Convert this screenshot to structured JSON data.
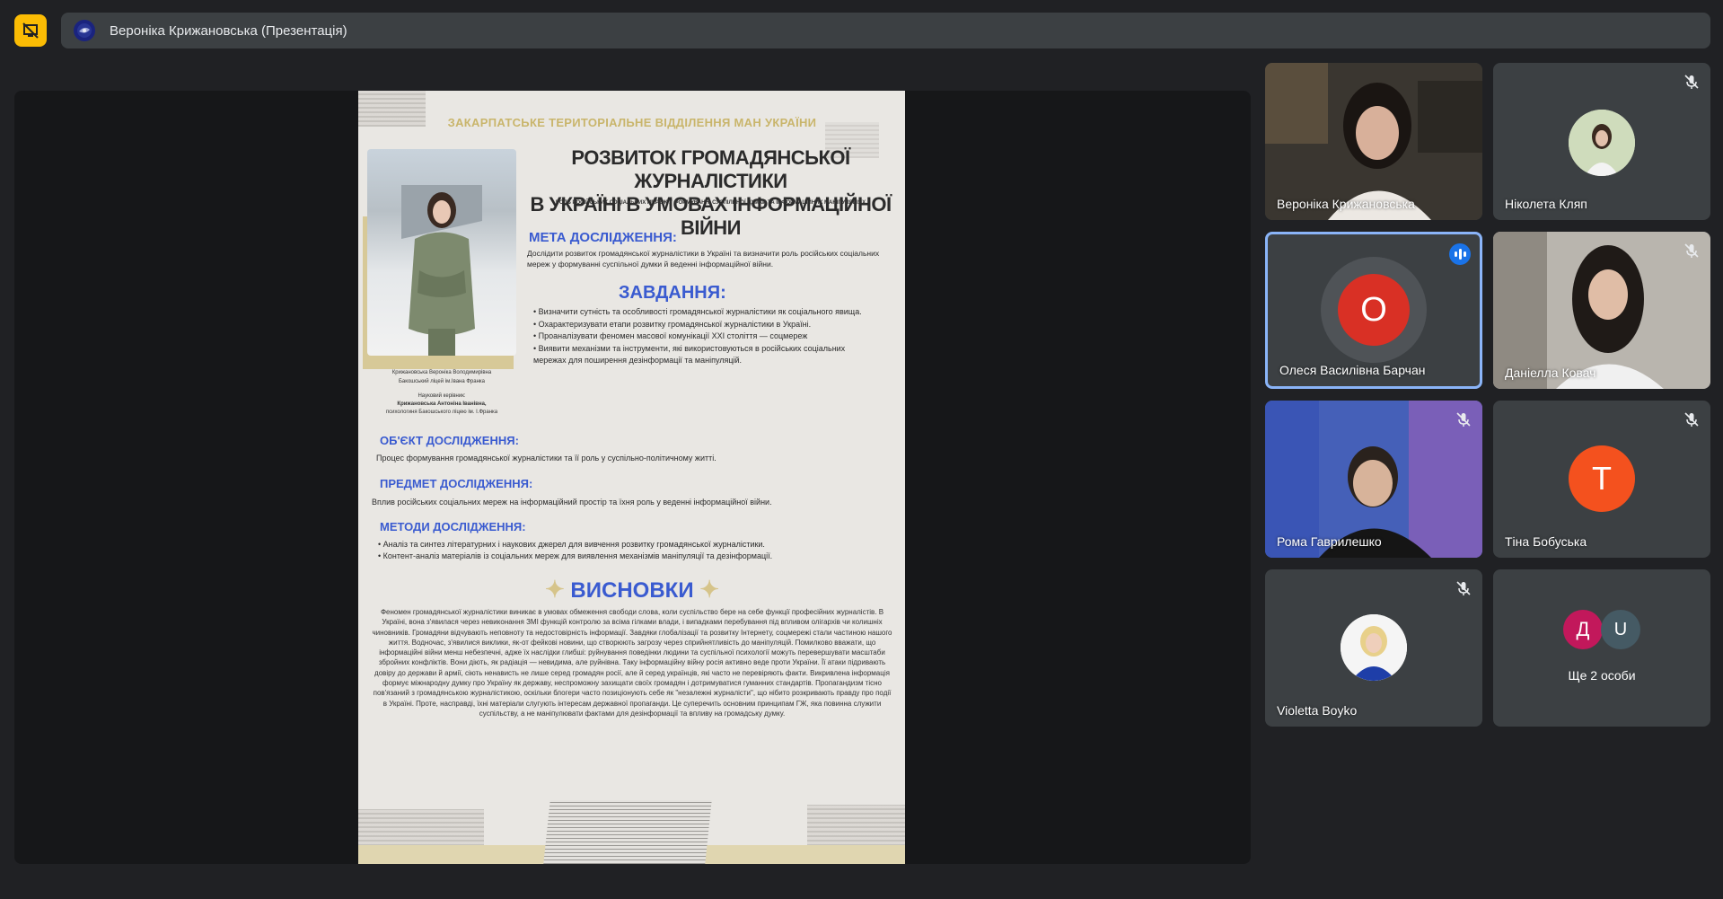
{
  "window": {
    "title": "Вероніка Крижановська (Презентація)"
  },
  "slide": {
    "org": "ЗАКАРПАТСЬКЕ ТЕРИТОРІАЛЬНЕ ВІДДІЛЕННЯ МАН УКРАЇНИ",
    "title_line1": "РОЗВИТОК ГРОМАДЯНСЬКОЇ ЖУРНАЛІСТИКИ",
    "title_line2": "В УКРАЇНІ В УМОВАХ ІНФОРМАЦІЙНОЇ ВІЙНИ",
    "subtitle": "РОЛЬ РОСІЙСЬКИХ СОЦІАЛЬНИХ МЕРЕЖ У ФОРМУВАННІ СУСПІЛЬНОЇ ДУМКИ ТА ІНФОРМАЦІЙНИХ МАНІПУЛЯЦІЯХ",
    "author": "Крижановська Вероніка Володимирівна",
    "school": "Бакошський ліцей ім.Івана Франка",
    "supervisor_label": "Науковий керівник:",
    "supervisor": "Крижановська Антоніна Іванівна,",
    "supervisor_role": "психологиня Бакошського ліцею ім. І.Франка",
    "goal_h": "МЕТА ДОСЛІДЖЕННЯ:",
    "goal_t": "Дослідити розвиток громадянської журналістики в Україні та визначити роль російських соціальних мереж у формуванні суспільної думки й веденні інформаційної війни.",
    "tasks_h": "ЗАВДАННЯ:",
    "tasks": [
      "Визначити сутність та особливості громадянської журналістики як соціального явища.",
      "Охарактеризувати етапи розвитку громадянської журналістики в Україні.",
      "Проаналізувати феномен масової комунікації XXI століття — соцмереж",
      "Виявити механізми та інструменти, які використовуються в російських соціальних мережах для поширення дезінформації та маніпуляцій."
    ],
    "object_h": "ОБ'ЄКТ ДОСЛІДЖЕННЯ:",
    "object_t": "Процес формування громадянської журналістики та її роль у суспільно-політичному житті.",
    "subject_h": "ПРЕДМЕТ ДОСЛІДЖЕННЯ:",
    "subject_t": "Вплив російських соціальних мереж на інформаційний простір та їхня роль у веденні інформаційної війни.",
    "methods_h": "МЕТОДИ ДОСЛІДЖЕННЯ:",
    "methods": [
      "Аналіз та синтез літературних і наукових джерел для вивчення розвитку громадянської журналістики.",
      "Контент-аналіз матеріалів із соціальних мереж для виявлення механізмів маніпуляції та дезінформації."
    ],
    "concl_h": "ВИСНОВКИ",
    "conclusions": "Феномен громадянської журналістики виникає в умовах обмеження свободи слова, коли суспільство бере на себе функції професійних журналістів. В Україні, вона з'явилася через невиконання ЗМІ функцій контролю за всіма гілками влади, і випадками перебування під впливом олігархів чи колишніх чиновників. Громадяни відчувають неповноту та недостовірність інформації. Завдяки глобалізації та розвитку Інтернету, соцмережі стали частиною нашого життя. Водночас, з'явилися виклики, як-от фейкові новини, що створюють загрозу через сприйнятливість до маніпуляцій. Помилково вважати, що інформаційні війни менш небезпечні, адже їх наслідки глибші: руйнування поведінки людини та суспільної психології можуть перевершувати масштаби збройних конфліктів. Вони діють, як радіація — невидима, але руйнівна. Таку інформаційну війну росія активно веде проти України. Її атаки підривають довіру до держави й армії, сіють ненависть не лише серед громадян росії, але й серед українців, які часто не перевіряють факти. Викривлена інформація формує міжнародну думку про Україну як державу, неспроможну захищати своїх громадян і дотримуватися гуманних стандартів. Пропагандизм тісно пов'язаний з громадянською журналістикою, оскільки блогери часто позиціонують себе як \"незалежні журналісти\", що нібито розкривають правду про події в Україні. Проте, насправді, їхні матеріали слугують інтересам державної пропаганди. Це суперечить основним принципам ГЖ, яка повинна служити суспільству, а не маніпулювати фактами для дезінформації та впливу на громадську думку."
  },
  "participants": [
    {
      "name": "Вероніка Крижановська",
      "type": "video",
      "muted": false
    },
    {
      "name": "Ніколета Кляп",
      "type": "photo",
      "muted": true
    },
    {
      "name": "Олеся Василівна Барчан",
      "type": "letter",
      "letter": "О",
      "color": "#d93025",
      "muted": false,
      "speaking": true
    },
    {
      "name": "Даніелла Ковач",
      "type": "video",
      "muted": true
    },
    {
      "name": "Рома Гаврилешко",
      "type": "video",
      "muted": true
    },
    {
      "name": "Тіна Бобуська",
      "type": "letter",
      "letter": "Т",
      "color": "#f4511e",
      "muted": true
    },
    {
      "name": "Violetta Boyko",
      "type": "photo",
      "muted": true
    },
    {
      "name": "Ще 2 особи",
      "type": "more",
      "letters": [
        "Д",
        "U"
      ],
      "colors": [
        "#c2185b",
        "#455a64"
      ]
    }
  ],
  "colors": {
    "present_accent": "#fbbc04",
    "tile_bg": "#3c4043",
    "active_border": "#8ab4f8",
    "accent_blue": "#3a5bd0"
  }
}
